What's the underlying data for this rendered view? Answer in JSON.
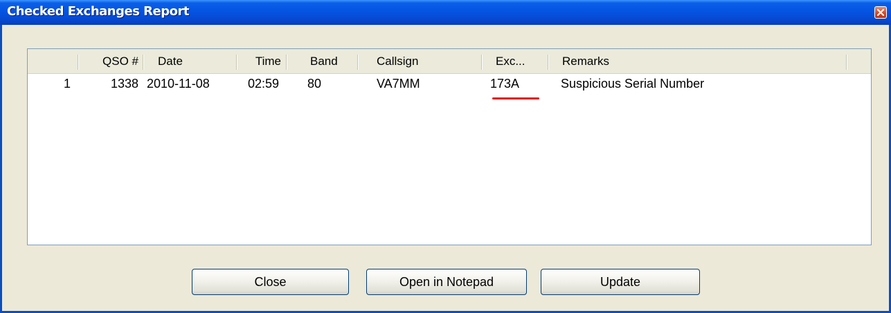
{
  "window": {
    "title": "Checked Exchanges Report"
  },
  "table": {
    "columns": [
      "",
      "QSO #",
      "Date",
      "Time",
      "Band",
      "Callsign",
      "Exc...",
      "Remarks"
    ],
    "rows": [
      {
        "index": "1",
        "qso": "1338",
        "date": "2010-11-08",
        "time": "02:59",
        "band": "80",
        "callsign": "VA7MM",
        "exchange": "173A",
        "remarks": "Suspicious Serial Number"
      }
    ]
  },
  "buttons": {
    "close": "Close",
    "notepad": "Open in Notepad",
    "update": "Update"
  },
  "colors": {
    "title_bar": "#0554e3",
    "highlight_underline": "#e0141b",
    "button_border": "#003c74"
  }
}
